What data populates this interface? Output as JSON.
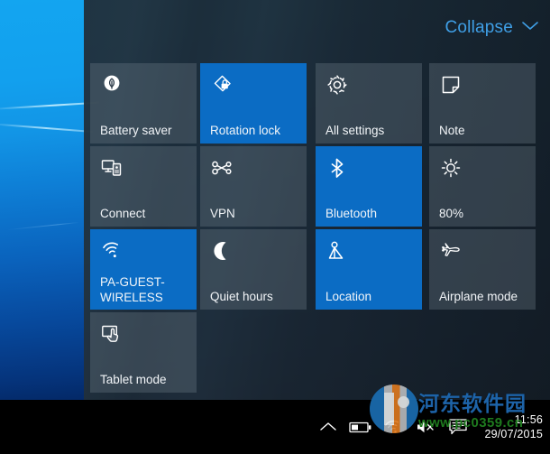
{
  "desktop": {
    "wallpaper_name": "windows-10-hero-wallpaper"
  },
  "action_center": {
    "collapse": {
      "label": "Collapse",
      "icon": "chevron-down-icon",
      "color": "#3f9fe6"
    },
    "colors": {
      "active_tile": "#0b6cc4",
      "inactive_tile": "rgba(112,125,138,0.34)",
      "panel": "rgba(26,35,44,0.93)"
    },
    "tiles": [
      {
        "label": "Battery saver",
        "icon": "battery-saver-leaf-icon",
        "state": "inactive",
        "col": 0,
        "row": 0
      },
      {
        "label": "Rotation lock",
        "icon": "rotation-lock-icon",
        "state": "active",
        "col": 1,
        "row": 0
      },
      {
        "label": "All settings",
        "icon": "gear-icon",
        "state": "inactive",
        "col": 2,
        "row": 0
      },
      {
        "label": "Note",
        "icon": "note-icon",
        "state": "inactive",
        "col": 3,
        "row": 0
      },
      {
        "label": "Connect",
        "icon": "connect-display-icon",
        "state": "inactive",
        "col": 0,
        "row": 1
      },
      {
        "label": "VPN",
        "icon": "vpn-icon",
        "state": "inactive",
        "col": 1,
        "row": 1
      },
      {
        "label": "Bluetooth",
        "icon": "bluetooth-icon",
        "state": "active",
        "col": 2,
        "row": 1
      },
      {
        "label": "80%",
        "icon": "brightness-sun-icon",
        "state": "inactive",
        "col": 3,
        "row": 1
      },
      {
        "label": "PA-GUEST-\nWIRELESS",
        "icon": "wifi-icon",
        "state": "active",
        "col": 0,
        "row": 2
      },
      {
        "label": "Quiet hours",
        "icon": "moon-icon",
        "state": "inactive",
        "col": 1,
        "row": 2
      },
      {
        "label": "Location",
        "icon": "location-icon",
        "state": "active",
        "col": 2,
        "row": 2
      },
      {
        "label": "Airplane mode",
        "icon": "airplane-icon",
        "state": "inactive",
        "col": 3,
        "row": 2
      },
      {
        "label": "Tablet mode",
        "icon": "tablet-mode-icon",
        "state": "inactive",
        "col": 0,
        "row": 3
      }
    ]
  },
  "taskbar": {
    "tray_icons": [
      {
        "name": "show-hidden-icons-chevron-up-icon"
      },
      {
        "name": "battery-icon"
      },
      {
        "name": "wifi-icon"
      },
      {
        "name": "volume-muted-icon"
      },
      {
        "name": "action-center-icon"
      }
    ],
    "clock": {
      "time": "11:56",
      "date": "29/07/2015"
    }
  },
  "watermark": {
    "site_name": "河东软件园",
    "url": "www.pc0359.cn",
    "logo": "circular-site-logo"
  }
}
